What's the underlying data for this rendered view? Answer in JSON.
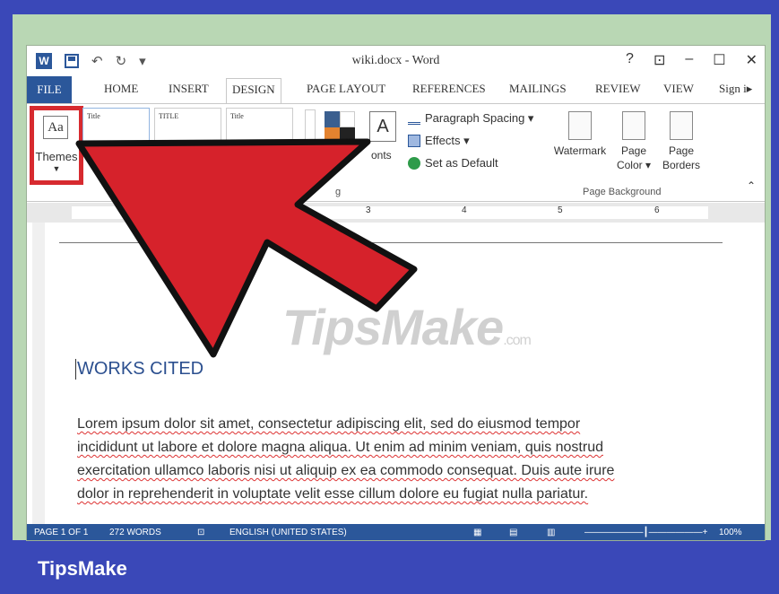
{
  "window": {
    "title": "wiki.docx - Word",
    "controls": [
      "?",
      "⊡",
      "–",
      "☐",
      "✕"
    ]
  },
  "tabs": [
    "FILE",
    "HOME",
    "INSERT",
    "DESIGN",
    "PAGE LAYOUT",
    "REFERENCES",
    "MAILINGS",
    "REVIEW",
    "VIEW",
    "Sign i▸"
  ],
  "active_tab": "DESIGN",
  "ribbon": {
    "themes_label": "Themes",
    "gallery": [
      "Title",
      "TITLE",
      "Title"
    ],
    "fonts_label": "onts",
    "paragraph_spacing": "Paragraph Spacing ▾",
    "effects": "Effects ▾",
    "set_as_default": "Set as Default",
    "group_doc_formatting": "g",
    "page_background": {
      "watermark": "Watermark",
      "page_color": "Page Color ▾",
      "page_borders": "Page Borders",
      "group_label": "Page Background"
    }
  },
  "ruler_marks": [
    "3",
    "4",
    "5",
    "6"
  ],
  "document": {
    "heading": "WORKS CITED",
    "body_lines": [
      "Lorem ipsum dolor sit amet, consectetur adipiscing elit, sed do eiusmod tempor",
      "incididunt ut labore et dolore magna aliqua. Ut enim ad minim veniam, quis nostrud",
      "exercitation ullamco laboris nisi ut aliquip ex ea commodo consequat. Duis aute irure",
      "dolor in reprehenderit in voluptate velit esse cillum dolore eu fugiat nulla pariatur."
    ]
  },
  "status": {
    "page": "PAGE 1 OF 1",
    "words": "272 WORDS",
    "language": "ENGLISH (UNITED STATES)",
    "zoom": "100%"
  },
  "watermark": "TipsMake",
  "watermark_suffix": ".com",
  "footer_brand": "TipsMake",
  "colors": {
    "word_blue": "#2b579a",
    "highlight_red": "#d72a2f",
    "footer_blue": "#3a48b8"
  }
}
